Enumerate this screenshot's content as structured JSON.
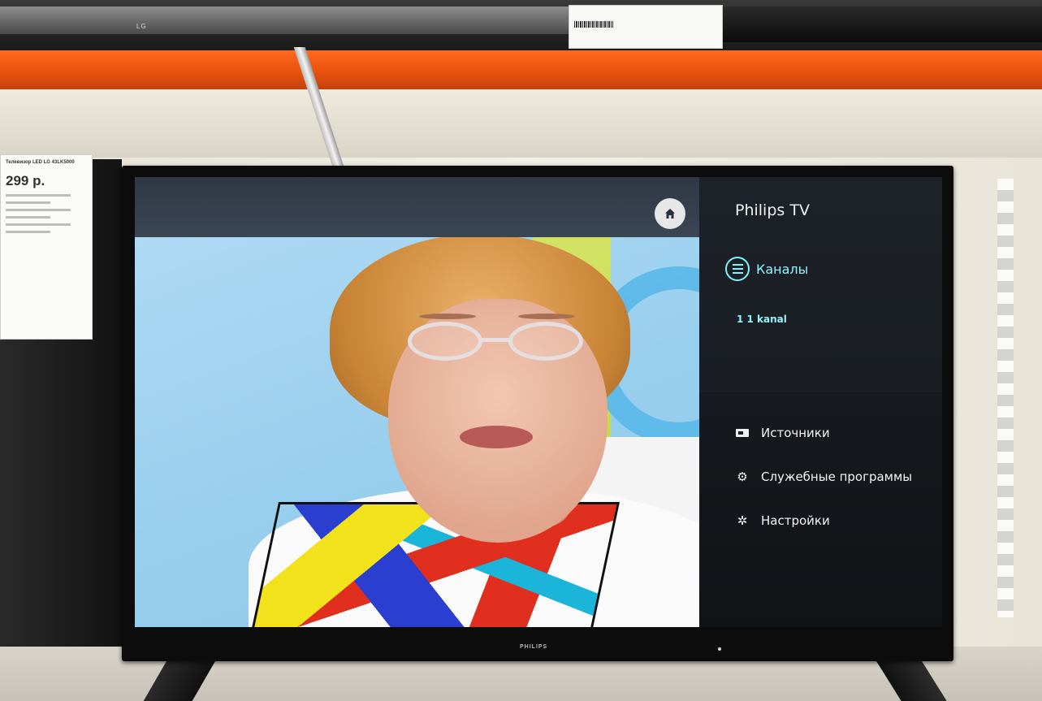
{
  "environment": {
    "upper_tv_logo": "LG",
    "left_tag": {
      "title": "Телевизор LED LG 43LK5000",
      "price": "299 р."
    }
  },
  "tv": {
    "brand": "PHILIPS"
  },
  "menu": {
    "title": "Philips TV",
    "channels": {
      "label": "Каналы",
      "item": "1  1 kanal"
    },
    "items": [
      {
        "label": "Источники",
        "icon": "sources-icon"
      },
      {
        "label": "Служебные программы",
        "icon": "gears-icon"
      },
      {
        "label": "Настройки",
        "icon": "gear-icon"
      }
    ],
    "home_icon": "home-icon"
  },
  "colors": {
    "accent": "#8ef3ff",
    "menu_bg": "#1a1e23",
    "shelf": "#e5500c"
  }
}
